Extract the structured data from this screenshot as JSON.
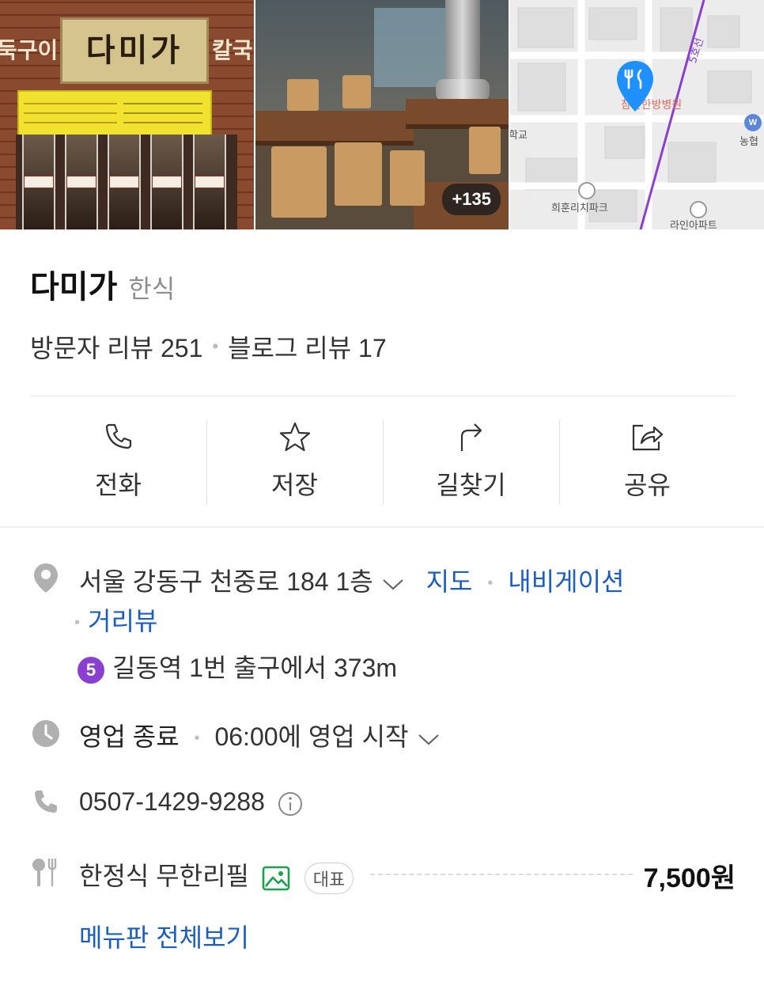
{
  "photos": {
    "storefront": {
      "sign_main": "다미가",
      "sign_left": "둑구이",
      "sign_right": "칼국"
    },
    "interior": {
      "more_count": "+135"
    },
    "map": {
      "hospital_label": "참손한방병원",
      "school_label": "학교",
      "park_label": "희훈리치파크",
      "apartment_label": "라인아파트",
      "bank_label": "농협",
      "line_label": "5호선"
    }
  },
  "place": {
    "name": "다미가",
    "category": "한식",
    "visitor_reviews": "방문자 리뷰 251",
    "blog_reviews": "블로그 리뷰 17"
  },
  "actions": [
    {
      "label": "전화",
      "icon": "phone-icon"
    },
    {
      "label": "저장",
      "icon": "star-icon"
    },
    {
      "label": "길찾기",
      "icon": "directions-icon"
    },
    {
      "label": "공유",
      "icon": "share-icon"
    }
  ],
  "info": {
    "address": "서울 강동구 천중로 184 1층",
    "map_link": "지도",
    "navigation_link": "내비게이션",
    "street_view_link": "거리뷰",
    "subway_line": "5",
    "subway_text": "길동역 1번 출구에서 373m",
    "hours_status": "영업 종료",
    "hours_next": "06:00에 영업 시작",
    "phone": "0507-1429-9288",
    "menu_name": "한정식 무한리필",
    "menu_badge": "대표",
    "menu_price": "7,500원",
    "menu_all_link": "메뉴판 전체보기"
  },
  "colors": {
    "link": "#1a5ec0",
    "line5": "#8b3fd1",
    "pin": "#1e90ff",
    "photo_icon": "#17a34a"
  }
}
